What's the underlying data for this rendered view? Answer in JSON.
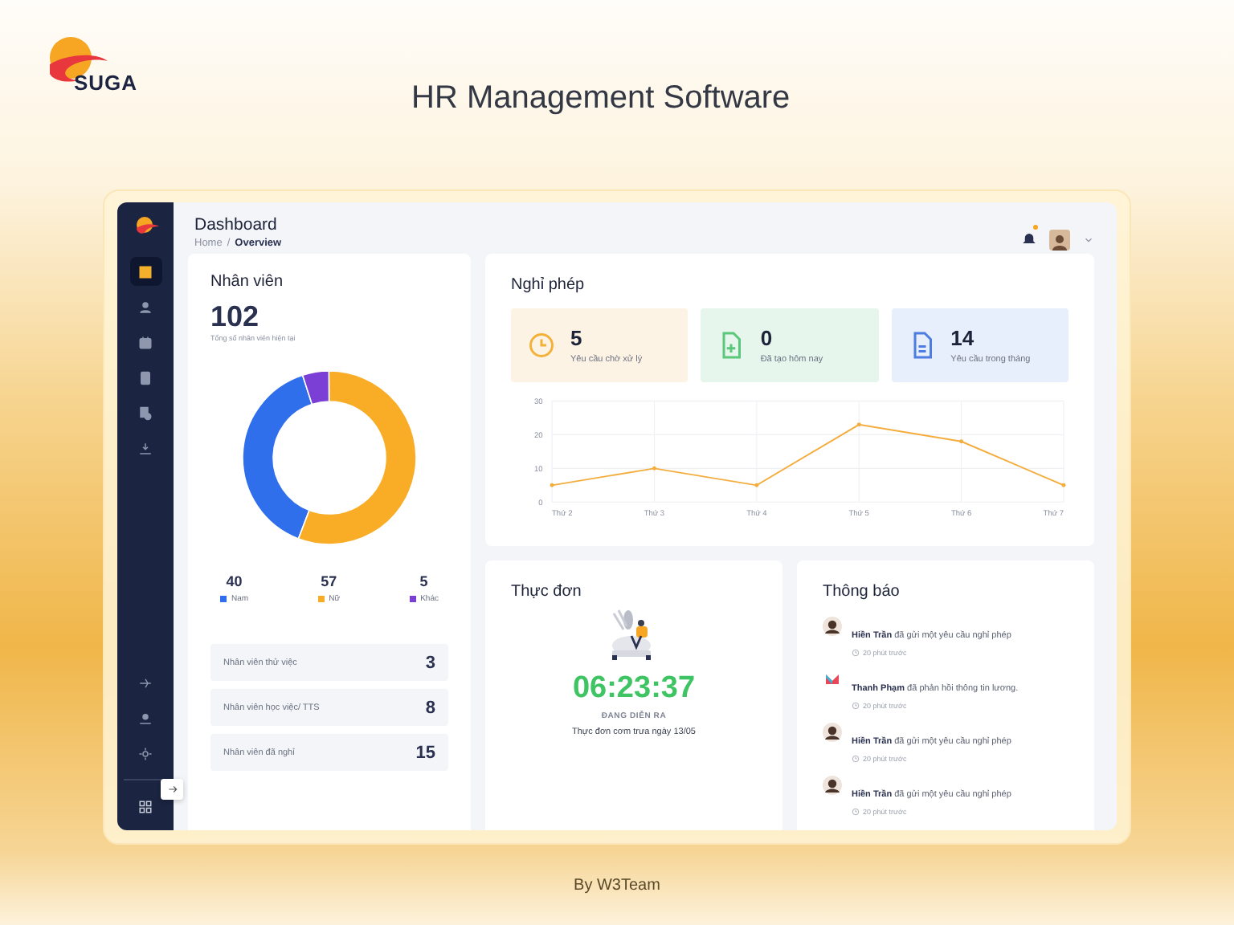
{
  "brand": {
    "logo_text": "SUGA",
    "title": "HR Management Software",
    "footer": "By W3Team"
  },
  "sidebar": {
    "nav_items": [
      {
        "selected": true
      },
      {
        "selected": false
      },
      {
        "selected": false
      },
      {
        "selected": false
      },
      {
        "selected": false
      },
      {
        "selected": false
      }
    ],
    "bottom_items": [
      {
        "selected": false
      },
      {
        "selected": false
      },
      {
        "selected": false
      }
    ]
  },
  "header": {
    "title": "Dashboard",
    "breadcrumb": [
      "Home",
      "Overview"
    ],
    "breadcrumb_separator": "/",
    "has_notification": true
  },
  "employees": {
    "title": "Nhân viên",
    "total": "102",
    "total_caption": "Tổng số nhân viên hiện tại",
    "chart_data": {
      "type": "donut",
      "categories": [
        "Nam",
        "Nữ",
        "Khác"
      ],
      "values": [
        39.2,
        55.9,
        4.9
      ],
      "colors": [
        "#2f6fec",
        "#f9ad26",
        "#7b3fd6"
      ]
    },
    "legend_counts": [
      "40",
      "57",
      "5"
    ],
    "rows": [
      {
        "label": "Nhân viên thử việc",
        "value": "3"
      },
      {
        "label": "Nhân viên học việc/ TTS",
        "value": "8"
      },
      {
        "label": "Nhân viên đã nghỉ",
        "value": "15"
      }
    ]
  },
  "leave": {
    "title": "Nghỉ phép",
    "stats": [
      {
        "kind": "pending",
        "value": "5",
        "label": "Yêu cầu chờ xử lý"
      },
      {
        "kind": "created",
        "value": "0",
        "label": "Đã tạo hôm nay"
      },
      {
        "kind": "month",
        "value": "14",
        "label": "Yêu cầu trong tháng"
      }
    ],
    "chart_data": {
      "type": "line",
      "categories": [
        "Thứ 2",
        "Thứ 3",
        "Thứ 4",
        "Thứ 5",
        "Thứ 6",
        "Thứ 7"
      ],
      "series": [
        {
          "color": "#f4ad3d",
          "values": [
            5,
            10,
            5,
            23,
            18,
            5
          ]
        }
      ],
      "ylim": [
        0,
        30
      ],
      "yticks": [
        0,
        10,
        20,
        30
      ],
      "grid": true
    }
  },
  "menu": {
    "title": "Thực đơn",
    "countdown": "06:23:37",
    "status": "ĐANG DIỄN RA",
    "caption": "Thực đơn cơm trưa ngày 13/05"
  },
  "notifications": {
    "title": "Thông báo",
    "items": [
      {
        "kind": "person",
        "text": "**Hiền Trần** đã gửi một yêu cầu nghỉ phép",
        "time": "20 phút trước"
      },
      {
        "kind": "logo",
        "text": "**Thanh Phạm** đã phản hồi thông tin lương.",
        "time": "20 phút trước"
      },
      {
        "kind": "person",
        "text": "**Hiền Trần** đã gửi một yêu cầu nghỉ phép",
        "time": "20 phút trước"
      },
      {
        "kind": "person",
        "text": "**Hiền Trần** đã gửi một yêu cầu nghỉ phép",
        "time": "20 phút trước"
      }
    ]
  }
}
